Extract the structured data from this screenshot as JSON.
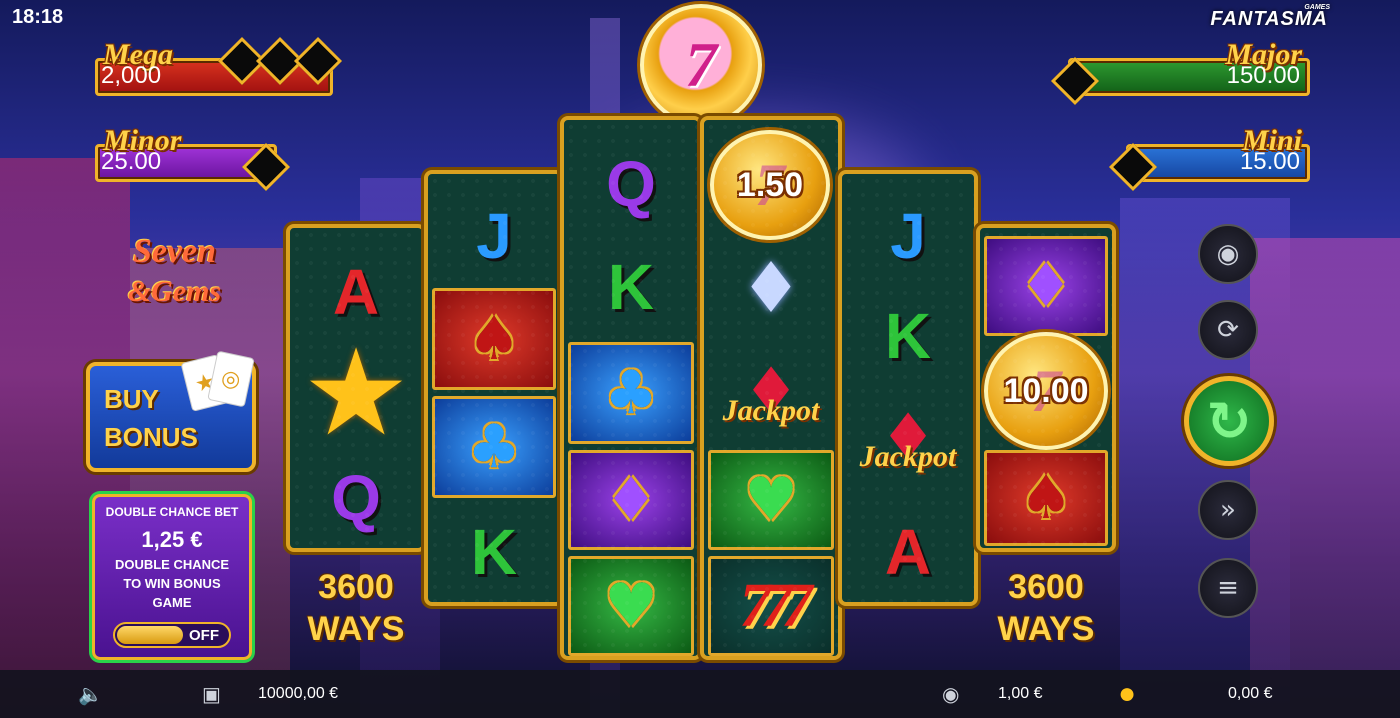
{
  "status": {
    "time": "18:18"
  },
  "brand": {
    "name": "FANTASMA",
    "sub": "GAMES"
  },
  "jackpots": {
    "mega": {
      "label": "Mega",
      "value": "2,000"
    },
    "minor": {
      "label": "Minor",
      "value": "25.00"
    },
    "major": {
      "label": "Major",
      "value": "150.00"
    },
    "mini": {
      "label": "Mini",
      "value": "15.00"
    }
  },
  "logo": {
    "line1": "Seven",
    "line2": "&Gems"
  },
  "buy_bonus": {
    "line1": "BUY",
    "line2": "BONUS"
  },
  "double_chance": {
    "header": "DOUBLE CHANCE BET",
    "amount": "1,25 €",
    "desc_line1": "DOUBLE CHANCE",
    "desc_line2": "TO WIN BONUS",
    "desc_line3": "GAME",
    "toggle_state": "OFF"
  },
  "ways": {
    "number": "3600",
    "label": "WAYS"
  },
  "coins": {
    "reel4_top": "1.50",
    "reel6_mid": "10.00",
    "top_symbol": "7"
  },
  "reels": {
    "reel1": [
      "A",
      "Q"
    ],
    "reel2": [
      "J",
      "K"
    ],
    "reel3": [
      "Q",
      "K"
    ],
    "reel5": [
      "J",
      "K",
      "A"
    ],
    "jackpot_label": "Jackpot"
  },
  "bottom_bar": {
    "balance": "10000,00 €",
    "bet": "1,00 €",
    "win": "0,00 €"
  },
  "icons": [
    "speaker-icon",
    "wallet-icon",
    "coins-stack-icon",
    "gold-coins-icon",
    "autoplay-icon",
    "spin-icon",
    "turbo-icon",
    "menu-icon"
  ],
  "colors": {
    "gold": "#f0b429",
    "reel_bg": "#0f3d33",
    "spin_green": "#2fb84a"
  }
}
